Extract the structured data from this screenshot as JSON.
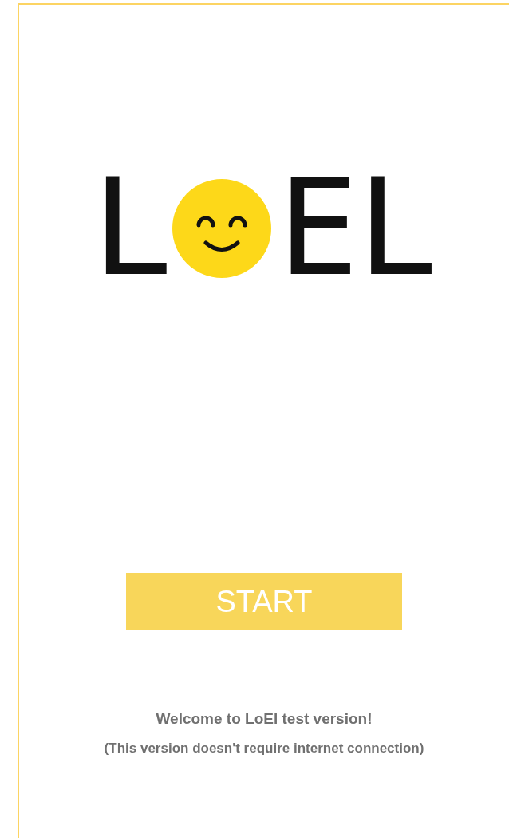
{
  "logo": {
    "before": "L",
    "after": "EL"
  },
  "start_button": {
    "label": "START"
  },
  "welcome": "Welcome to LoEl test version!",
  "note": "(This version doesn't require internet connection)"
}
